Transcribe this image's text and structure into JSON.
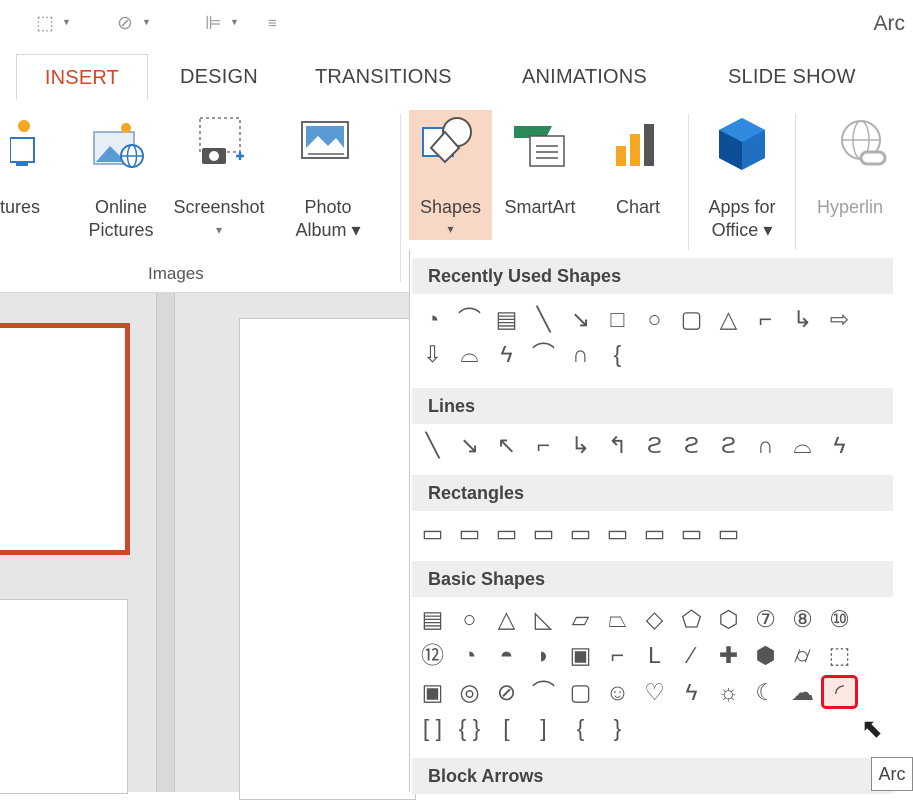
{
  "qat": {
    "icons": [
      "slide-layout-icon",
      "circle-shape-icon",
      "align-icon"
    ],
    "customize_icon": "customize-qat-icon"
  },
  "window": {
    "title": "Arc"
  },
  "tabs": [
    {
      "label": "INSERT",
      "active": true
    },
    {
      "label": "DESIGN"
    },
    {
      "label": "TRANSITIONS"
    },
    {
      "label": "ANIMATIONS"
    },
    {
      "label": "SLIDE SHOW"
    }
  ],
  "ribbon": {
    "pictures_label": "tures",
    "online_pictures_label_1": "Online",
    "online_pictures_label_2": "Pictures",
    "screenshot_label": "Screenshot",
    "screenshot_drop": "▾",
    "photo_album_label_1": "Photo",
    "photo_album_label_2": "Album ▾",
    "images_group_title": "Images",
    "shapes_label": "Shapes",
    "shapes_drop": "▾",
    "smartart_label": "SmartArt",
    "chart_label": "Chart",
    "apps_label_1": "Apps for",
    "apps_label_2": "Office ▾",
    "hyperlink_label": "Hyperlin"
  },
  "gallery": {
    "recent_title": "Recently Used Shapes",
    "lines_title": "Lines",
    "rectangles_title": "Rectangles",
    "basic_title": "Basic Shapes",
    "block_arrows_title": "Block Arrows",
    "recent_row1": [
      "◔",
      "⌒",
      "▤",
      "╲",
      "↘",
      "□",
      "○",
      "▢",
      "△",
      "⌐",
      "↳",
      "⇨"
    ],
    "recent_row2": [
      "⇩",
      "⌓",
      "ϟ",
      "⌒",
      "∩",
      "{"
    ],
    "lines_row": [
      "╲",
      "↘",
      "↖",
      "⌐",
      "↳",
      "↰",
      "ϩ",
      "ϩ",
      "ϩ",
      "∩",
      "⌓",
      "ϟ"
    ],
    "rect_row": [
      "▭",
      "▭",
      "▭",
      "▭",
      "▭",
      "▭",
      "▭",
      "▭",
      "▭"
    ],
    "basic_row1": [
      "▤",
      "○",
      "△",
      "◺",
      "▱",
      "⏢",
      "◇",
      "⬠",
      "⬡",
      "⑦",
      "⑧",
      "⑩"
    ],
    "basic_row2": [
      "⑫",
      "◔",
      "◓",
      "◗",
      "▣",
      "⌐",
      "L",
      "∕",
      "✚",
      "⬢",
      "⌭",
      "⬚"
    ],
    "basic_row3": [
      "▣",
      "◎",
      "⊘",
      "⌒",
      "▢",
      "☺",
      "♡",
      "ϟ",
      "☼",
      "☾",
      "☁",
      "◜"
    ],
    "basic_row4": [
      "[ ]",
      "{ }",
      "[",
      "]",
      "{",
      "}"
    ]
  },
  "tooltip": {
    "text": "Arc"
  }
}
